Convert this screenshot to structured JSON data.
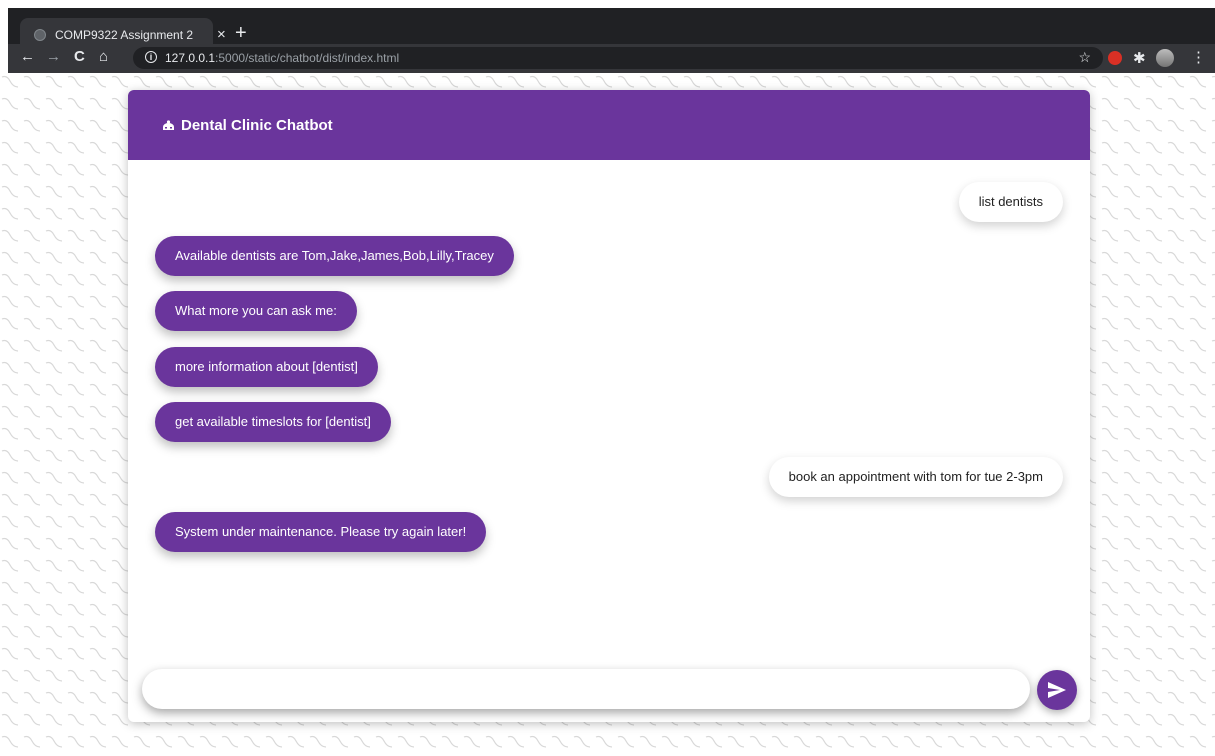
{
  "browser": {
    "tab_title": "COMP9322 Assignment 2",
    "tab_close": "×",
    "new_tab": "+",
    "url_host": "127.0.0.1",
    "url_rest": ":5000/static/chatbot/dist/index.html",
    "nav": {
      "back": "←",
      "forward": "→",
      "reload": "C",
      "home": "⌂"
    },
    "star": "☆",
    "menu": "⋮"
  },
  "chat": {
    "title": "Dental Clinic Chatbot",
    "accent_color": "#6a359c",
    "messages": [
      {
        "sender": "user",
        "text": "list dentists"
      },
      {
        "sender": "bot",
        "text": "Available dentists are Tom,Jake,James,Bob,Lilly,Tracey"
      },
      {
        "sender": "bot",
        "text": "What more you can ask me:"
      },
      {
        "sender": "bot",
        "text": "more information about [dentist]"
      },
      {
        "sender": "bot",
        "text": "get available timeslots for [dentist]"
      },
      {
        "sender": "user",
        "text": "book an appointment with tom for tue 2-3pm"
      },
      {
        "sender": "bot",
        "text": "System under maintenance. Please try again later!"
      }
    ],
    "input": {
      "value": "",
      "placeholder": ""
    },
    "send_icon": "send-icon"
  }
}
